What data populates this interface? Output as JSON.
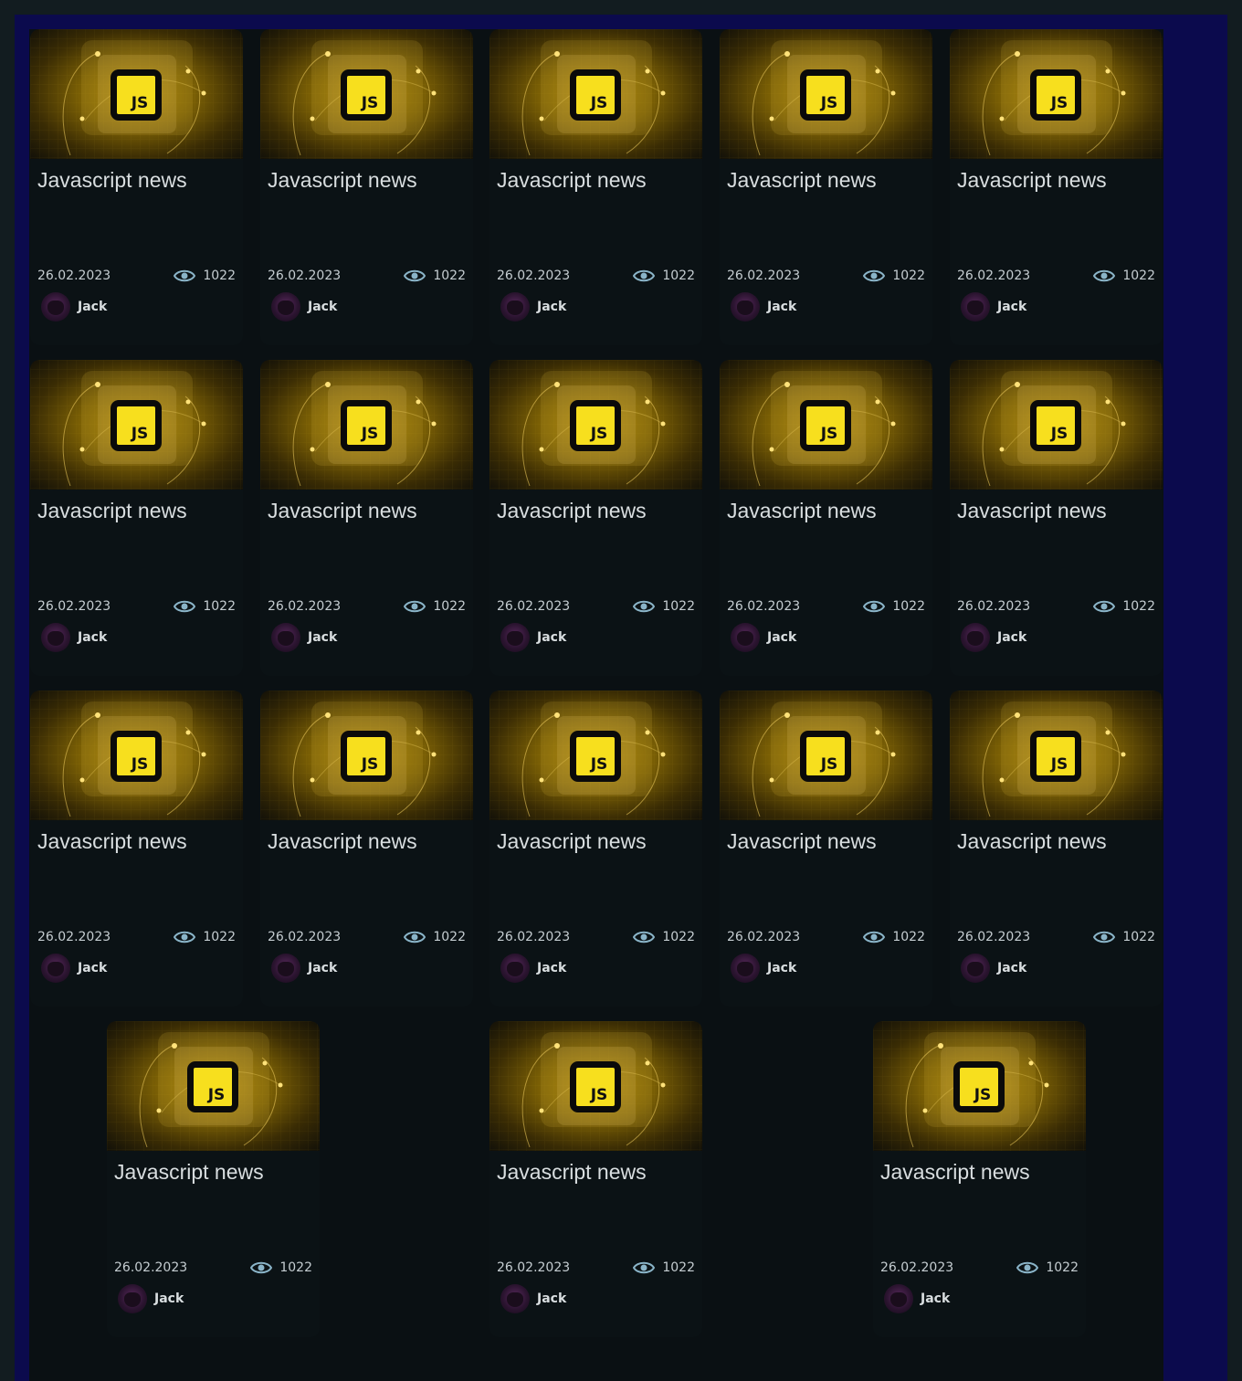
{
  "colors": {
    "page_bg": "#121c20",
    "frame_bg": "#0b0a4d",
    "card_bg": "#0b1215",
    "js_badge": "#f7df1e",
    "text": "#d9dee0",
    "eye_icon": "#8ab4c8"
  },
  "cards": [
    {
      "title": "Javascript news",
      "date": "26.02.2023",
      "views": "1022",
      "author": "Jack",
      "badge": "JS",
      "icon": "javascript-logo"
    },
    {
      "title": "Javascript news",
      "date": "26.02.2023",
      "views": "1022",
      "author": "Jack",
      "badge": "JS",
      "icon": "javascript-logo"
    },
    {
      "title": "Javascript news",
      "date": "26.02.2023",
      "views": "1022",
      "author": "Jack",
      "badge": "JS",
      "icon": "javascript-logo"
    },
    {
      "title": "Javascript news",
      "date": "26.02.2023",
      "views": "1022",
      "author": "Jack",
      "badge": "JS",
      "icon": "javascript-logo"
    },
    {
      "title": "Javascript news",
      "date": "26.02.2023",
      "views": "1022",
      "author": "Jack",
      "badge": "JS",
      "icon": "javascript-logo"
    },
    {
      "title": "Javascript news",
      "date": "26.02.2023",
      "views": "1022",
      "author": "Jack",
      "badge": "JS",
      "icon": "javascript-logo"
    },
    {
      "title": "Javascript news",
      "date": "26.02.2023",
      "views": "1022",
      "author": "Jack",
      "badge": "JS",
      "icon": "javascript-logo"
    },
    {
      "title": "Javascript news",
      "date": "26.02.2023",
      "views": "1022",
      "author": "Jack",
      "badge": "JS",
      "icon": "javascript-logo"
    },
    {
      "title": "Javascript news",
      "date": "26.02.2023",
      "views": "1022",
      "author": "Jack",
      "badge": "JS",
      "icon": "javascript-logo"
    },
    {
      "title": "Javascript news",
      "date": "26.02.2023",
      "views": "1022",
      "author": "Jack",
      "badge": "JS",
      "icon": "javascript-logo"
    },
    {
      "title": "Javascript news",
      "date": "26.02.2023",
      "views": "1022",
      "author": "Jack",
      "badge": "JS",
      "icon": "javascript-logo"
    },
    {
      "title": "Javascript news",
      "date": "26.02.2023",
      "views": "1022",
      "author": "Jack",
      "badge": "JS",
      "icon": "javascript-logo"
    },
    {
      "title": "Javascript news",
      "date": "26.02.2023",
      "views": "1022",
      "author": "Jack",
      "badge": "JS",
      "icon": "javascript-logo"
    },
    {
      "title": "Javascript news",
      "date": "26.02.2023",
      "views": "1022",
      "author": "Jack",
      "badge": "JS",
      "icon": "javascript-logo"
    },
    {
      "title": "Javascript news",
      "date": "26.02.2023",
      "views": "1022",
      "author": "Jack",
      "badge": "JS",
      "icon": "javascript-logo"
    },
    {
      "title": "Javascript news",
      "date": "26.02.2023",
      "views": "1022",
      "author": "Jack",
      "badge": "JS",
      "icon": "javascript-logo"
    },
    {
      "title": "Javascript news",
      "date": "26.02.2023",
      "views": "1022",
      "author": "Jack",
      "badge": "JS",
      "icon": "javascript-logo"
    },
    {
      "title": "Javascript news",
      "date": "26.02.2023",
      "views": "1022",
      "author": "Jack",
      "badge": "JS",
      "icon": "javascript-logo"
    }
  ]
}
